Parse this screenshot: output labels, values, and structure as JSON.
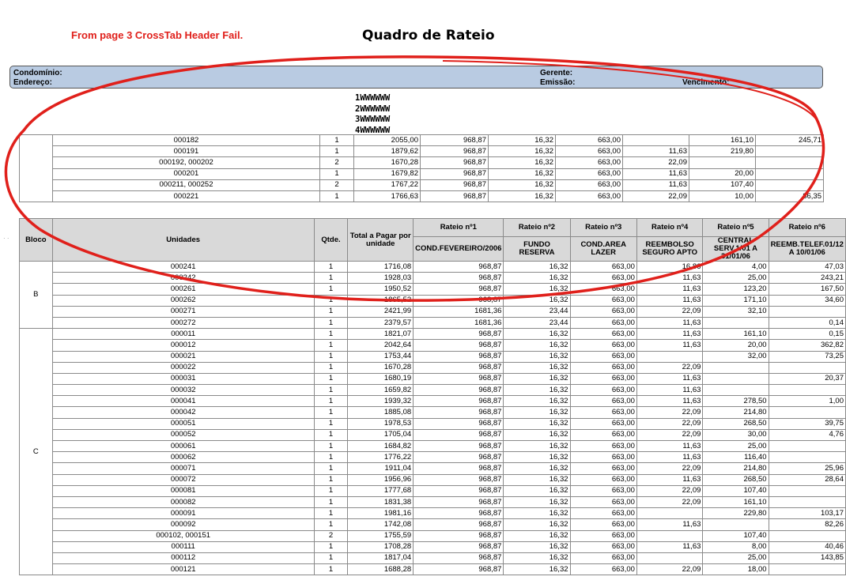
{
  "annotation": "From page 3 CrossTab Header Fail.",
  "title": "Quadro de Rateio",
  "info": {
    "condominio": "Condomínio:",
    "endereco": "Endereço:",
    "gerente": "Gerente:",
    "emissao": "Emissão:",
    "vencimento": "Vencimento:"
  },
  "ww_lines": [
    "1WWWWWW",
    "2WWWWWW",
    "3WWWWWW",
    "4WWWWWW"
  ],
  "upper_rows": [
    [
      "000182",
      "1",
      "2055,00",
      "968,87",
      "16,32",
      "663,00",
      "",
      "161,10",
      "245,71"
    ],
    [
      "000191",
      "1",
      "1879,62",
      "968,87",
      "16,32",
      "663,00",
      "11,63",
      "219,80",
      ""
    ],
    [
      "000192, 000202",
      "2",
      "1670,28",
      "968,87",
      "16,32",
      "663,00",
      "22,09",
      "",
      ""
    ],
    [
      "000201",
      "1",
      "1679,82",
      "968,87",
      "16,32",
      "663,00",
      "11,63",
      "20,00",
      ""
    ],
    [
      "000211, 000252",
      "2",
      "1767,22",
      "968,87",
      "16,32",
      "663,00",
      "11,63",
      "107,40",
      ""
    ],
    [
      "000221",
      "1",
      "1766,63",
      "968,87",
      "16,32",
      "663,00",
      "22,09",
      "10,00",
      "86,35"
    ]
  ],
  "headers": {
    "bloco": "Bloco",
    "unidades": "Unidades",
    "qtde": "Qtde.",
    "total": "Total a Pagar por unidade",
    "rateios": [
      {
        "title": "Rateio nº1",
        "desc": "COND.FEVEREIRO/2006"
      },
      {
        "title": "Rateio nº2",
        "desc": "FUNDO RESERVA"
      },
      {
        "title": "Rateio nº3",
        "desc": "COND.AREA LAZER"
      },
      {
        "title": "Rateio nº4",
        "desc": "REEMBOLSO SEGURO APTO"
      },
      {
        "title": "Rateio nº5",
        "desc": "CENTRAL SERV.1/01 A 31/01/06"
      },
      {
        "title": "Rateio nº6",
        "desc": "REEMB.TELEF.01/12 A 10/01/06"
      }
    ]
  },
  "blocks": [
    {
      "name": "B",
      "rows": [
        [
          "000241",
          "1",
          "1716,08",
          "968,87",
          "16,32",
          "663,00",
          "16,86",
          "4,00",
          "47,03"
        ],
        [
          "000242",
          "1",
          "1928,03",
          "968,87",
          "16,32",
          "663,00",
          "11,63",
          "25,00",
          "243,21"
        ],
        [
          "000261",
          "1",
          "1950,52",
          "968,87",
          "16,32",
          "663,00",
          "11,63",
          "123,20",
          "167,50"
        ],
        [
          "000262",
          "1",
          "1865,52",
          "968,87",
          "16,32",
          "663,00",
          "11,63",
          "171,10",
          "34,60"
        ],
        [
          "000271",
          "1",
          "2421,99",
          "1681,36",
          "23,44",
          "663,00",
          "22,09",
          "32,10",
          ""
        ],
        [
          "000272",
          "1",
          "2379,57",
          "1681,36",
          "23,44",
          "663,00",
          "11,63",
          "",
          "0,14"
        ]
      ]
    },
    {
      "name": "C",
      "rows": [
        [
          "000011",
          "1",
          "1821,07",
          "968,87",
          "16,32",
          "663,00",
          "11,63",
          "161,10",
          "0,15"
        ],
        [
          "000012",
          "1",
          "2042,64",
          "968,87",
          "16,32",
          "663,00",
          "11,63",
          "20,00",
          "362,82"
        ],
        [
          "000021",
          "1",
          "1753,44",
          "968,87",
          "16,32",
          "663,00",
          "",
          "32,00",
          "73,25"
        ],
        [
          "000022",
          "1",
          "1670,28",
          "968,87",
          "16,32",
          "663,00",
          "22,09",
          "",
          ""
        ],
        [
          "000031",
          "1",
          "1680,19",
          "968,87",
          "16,32",
          "663,00",
          "11,63",
          "",
          "20,37"
        ],
        [
          "000032",
          "1",
          "1659,82",
          "968,87",
          "16,32",
          "663,00",
          "11,63",
          "",
          ""
        ],
        [
          "000041",
          "1",
          "1939,32",
          "968,87",
          "16,32",
          "663,00",
          "11,63",
          "278,50",
          "1,00"
        ],
        [
          "000042",
          "1",
          "1885,08",
          "968,87",
          "16,32",
          "663,00",
          "22,09",
          "214,80",
          ""
        ],
        [
          "000051",
          "1",
          "1978,53",
          "968,87",
          "16,32",
          "663,00",
          "22,09",
          "268,50",
          "39,75"
        ],
        [
          "000052",
          "1",
          "1705,04",
          "968,87",
          "16,32",
          "663,00",
          "22,09",
          "30,00",
          "4,76"
        ],
        [
          "000061",
          "1",
          "1684,82",
          "968,87",
          "16,32",
          "663,00",
          "11,63",
          "25,00",
          ""
        ],
        [
          "000062",
          "1",
          "1776,22",
          "968,87",
          "16,32",
          "663,00",
          "11,63",
          "116,40",
          ""
        ],
        [
          "000071",
          "1",
          "1911,04",
          "968,87",
          "16,32",
          "663,00",
          "22,09",
          "214,80",
          "25,96"
        ],
        [
          "000072",
          "1",
          "1956,96",
          "968,87",
          "16,32",
          "663,00",
          "11,63",
          "268,50",
          "28,64"
        ],
        [
          "000081",
          "1",
          "1777,68",
          "968,87",
          "16,32",
          "663,00",
          "22,09",
          "107,40",
          ""
        ],
        [
          "000082",
          "1",
          "1831,38",
          "968,87",
          "16,32",
          "663,00",
          "22,09",
          "161,10",
          ""
        ],
        [
          "000091",
          "1",
          "1981,16",
          "968,87",
          "16,32",
          "663,00",
          "",
          "229,80",
          "103,17"
        ],
        [
          "000092",
          "1",
          "1742,08",
          "968,87",
          "16,32",
          "663,00",
          "11,63",
          "",
          "82,26"
        ],
        [
          "000102, 000151",
          "2",
          "1755,59",
          "968,87",
          "16,32",
          "663,00",
          "",
          "107,40",
          ""
        ],
        [
          "000111",
          "1",
          "1708,28",
          "968,87",
          "16,32",
          "663,00",
          "11,63",
          "8,00",
          "40,46"
        ],
        [
          "000112",
          "1",
          "1817,04",
          "968,87",
          "16,32",
          "663,00",
          "",
          "25,00",
          "143,85"
        ],
        [
          "000121",
          "1",
          "1688,28",
          "968,87",
          "16,32",
          "663,00",
          "22,09",
          "18,00",
          ""
        ]
      ]
    }
  ]
}
